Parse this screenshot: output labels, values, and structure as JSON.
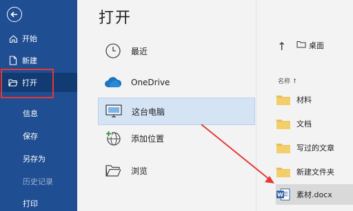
{
  "sidebar": {
    "items": [
      {
        "label": "开始"
      },
      {
        "label": "新建"
      },
      {
        "label": "打开"
      },
      {
        "label": "信息"
      },
      {
        "label": "保存"
      },
      {
        "label": "另存为"
      },
      {
        "label": "历史记录"
      },
      {
        "label": "打印"
      }
    ]
  },
  "page": {
    "title": "打开"
  },
  "locations": [
    {
      "label": "最近"
    },
    {
      "label": "OneDrive"
    },
    {
      "label": "这台电脑"
    },
    {
      "label": "添加位置"
    },
    {
      "label": "浏览"
    }
  ],
  "browser": {
    "current_folder": "桌面",
    "sort_label": "名称 ↑",
    "items": [
      {
        "name": "材料"
      },
      {
        "name": "文档"
      },
      {
        "name": "写过的文章"
      },
      {
        "name": "新建文件夹"
      },
      {
        "name": "素材.docx"
      }
    ]
  },
  "colors": {
    "sidebar_bg": "#1f4e93",
    "annotation_red": "#e53935",
    "selected_bg": "#d5e4f5"
  }
}
